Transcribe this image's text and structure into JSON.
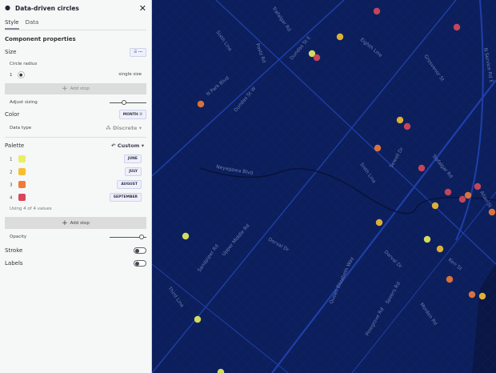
{
  "panel": {
    "title": "Data-driven circles",
    "tabs": [
      "Style",
      "Data"
    ],
    "section_title": "Component properties",
    "size": {
      "label": "Size",
      "circle_radius_label": "Circle radius",
      "stop_index": "1",
      "single_size": "single size",
      "add_stop": "Add stop",
      "adjust_sizing": "Adjust sizing",
      "adjust_sizing_value": 0.4
    },
    "color": {
      "label": "Color",
      "field_button": "MONTH",
      "field_suffix": "ꕤ",
      "data_type_label": "Data type",
      "data_type_value": "Discrete"
    },
    "palette": {
      "label": "Palette",
      "preset": "Custom",
      "stops": [
        {
          "index": "1",
          "color": "#e8f060",
          "value": "JUNE"
        },
        {
          "index": "2",
          "color": "#f5bf32",
          "value": "JULY"
        },
        {
          "index": "3",
          "color": "#f07a38",
          "value": "AUGUST"
        },
        {
          "index": "4",
          "color": "#d9485a",
          "value": "SEPTEMBER"
        }
      ],
      "using": "Using 4 of 4 values",
      "add_stop": "Add stop"
    },
    "opacity": {
      "label": "Opacity",
      "value": 0.9
    },
    "stroke": {
      "label": "Stroke",
      "on": false
    },
    "labels": {
      "label": "Labels",
      "on": false
    }
  },
  "map": {
    "streets": [
      "Trafalgar Rd",
      "Sixth Line",
      "Postz Rd",
      "Dundas St E",
      "Eighth Line",
      "Grosvenor St",
      "N Service Rd E",
      "N Park Blvd",
      "Dundas St W",
      "Neyagawa Blvd",
      "Sixth Line",
      "Sewell Dr",
      "Trafalgar Rd",
      "Allan St",
      "Upper Middle Rd",
      "Dorval Dr",
      "Sandpiper Rd",
      "Third Line",
      "Queen Elizabeth Way",
      "Dorval Dr",
      "Kerr St",
      "Speers Rd",
      "Morden Rd",
      "Pinegrove Rd"
    ]
  }
}
